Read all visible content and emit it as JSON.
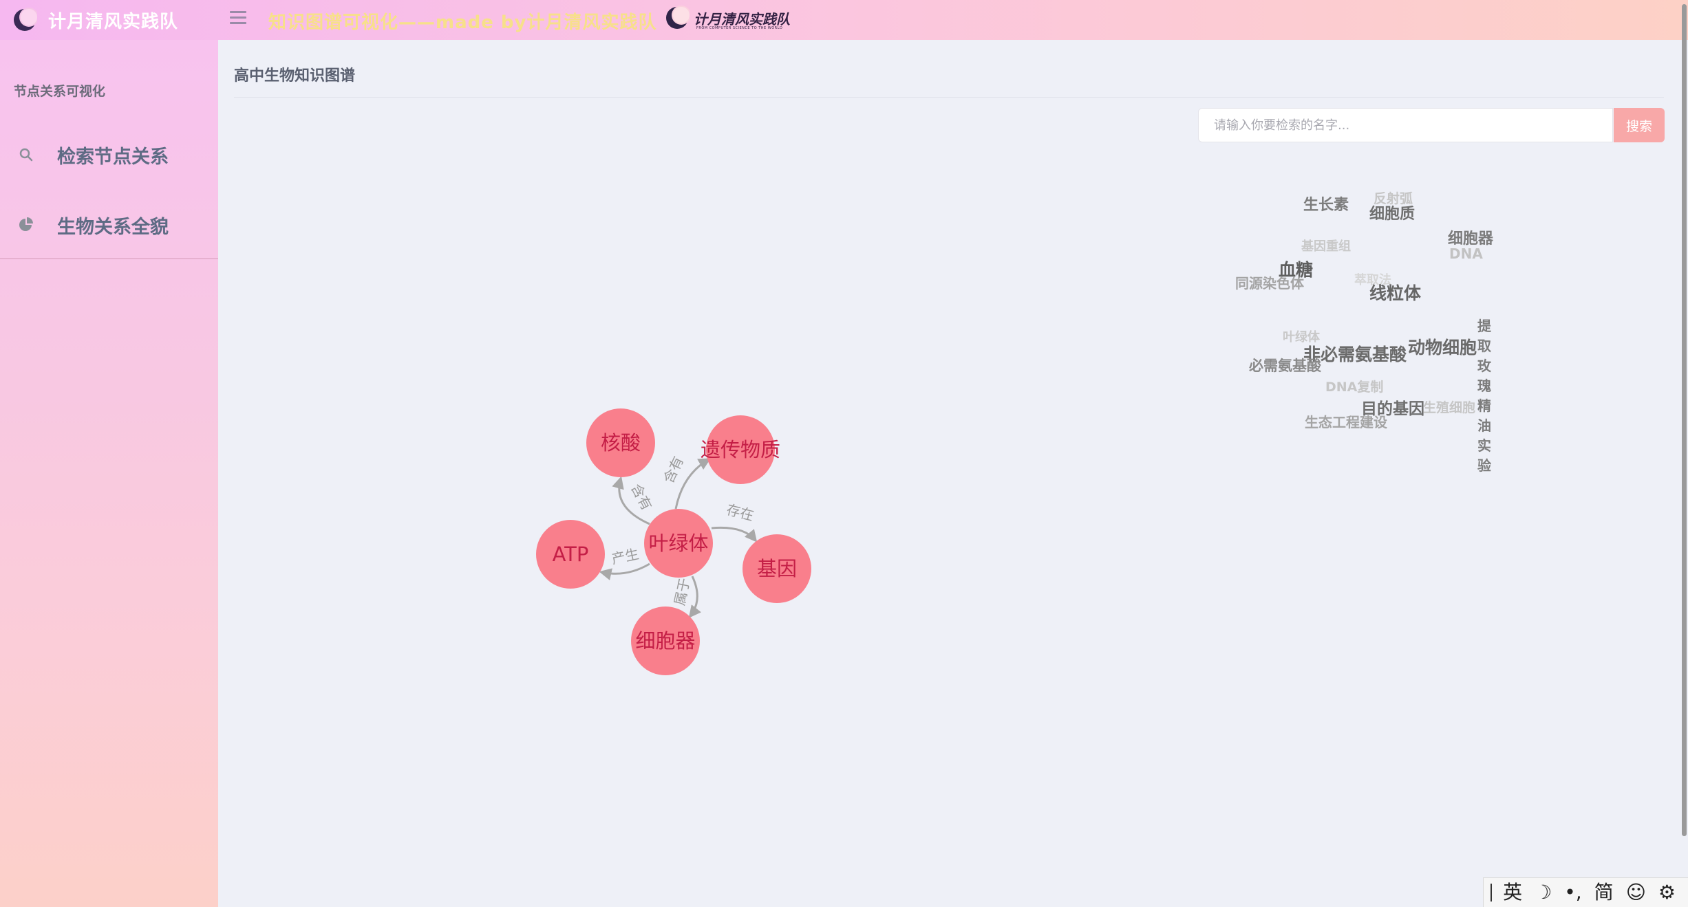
{
  "header": {
    "brand": "计月清风实践队",
    "title": "知识图谱可视化——made by计月清风实践队",
    "logo_text": "计月清风实践队",
    "logo_subtext": "FROM COMPUTER SCIENCE TO THE WORLD"
  },
  "sidebar": {
    "section_title": "节点关系可视化",
    "items": [
      {
        "label": "检索节点关系",
        "icon": "search-icon"
      },
      {
        "label": "生物关系全貌",
        "icon": "pie-chart-icon"
      }
    ]
  },
  "main": {
    "title": "高中生物知识图谱",
    "search": {
      "placeholder": "请输入你要检索的名字...",
      "value": "",
      "button_label": "搜索"
    }
  },
  "graph": {
    "center": "叶绿体",
    "nodes": [
      "叶绿体",
      "核酸",
      "遗传物质",
      "基因",
      "细胞器",
      "ATP"
    ],
    "edges": [
      {
        "from": "叶绿体",
        "to": "核酸",
        "label": "含有"
      },
      {
        "from": "叶绿体",
        "to": "遗传物质",
        "label": "含有"
      },
      {
        "from": "叶绿体",
        "to": "基因",
        "label": "存在"
      },
      {
        "from": "叶绿体",
        "to": "细胞器",
        "label": "属于"
      },
      {
        "from": "叶绿体",
        "to": "ATP",
        "label": "产生"
      }
    ],
    "node_color": "#f97f8c",
    "node_text_color": "#c41e46",
    "edge_color": "#a8a8a8",
    "edge_label_color": "#9a9a9a"
  },
  "word_cloud": {
    "words": [
      {
        "text": "生长素",
        "color": "#7c7c7c"
      },
      {
        "text": "反射弧",
        "color": "#c6c6c6"
      },
      {
        "text": "细胞质",
        "color": "#6f6f6f"
      },
      {
        "text": "细胞器",
        "color": "#7c7c7c"
      },
      {
        "text": "基因重组",
        "color": "#c9c9c9"
      },
      {
        "text": "DNA",
        "color": "#c2c2c2"
      },
      {
        "text": "血糖",
        "color": "#5e5e5e"
      },
      {
        "text": "同源染色体",
        "color": "#a4a4a4"
      },
      {
        "text": "萃取法",
        "color": "#d6d6d6"
      },
      {
        "text": "线粒体",
        "color": "#666666"
      },
      {
        "text": "叶绿体",
        "color": "#c9c9c9"
      },
      {
        "text": "非必需氨基酸",
        "color": "#6a6a6a"
      },
      {
        "text": "动物细胞",
        "color": "#6a6a6a"
      },
      {
        "text": "必需氨基酸",
        "color": "#8a8a8a"
      },
      {
        "text": "DNA复制",
        "color": "#c6c6c6"
      },
      {
        "text": "目的基因",
        "color": "#6e6e6e"
      },
      {
        "text": "生殖细胞",
        "color": "#c6c6c6"
      },
      {
        "text": "生态工程建设",
        "color": "#a4a4a4"
      }
    ],
    "vertical_word": [
      "提",
      "取",
      "玫",
      "瑰",
      "精",
      "油",
      "实",
      "验"
    ]
  },
  "ime": {
    "items": [
      "英",
      "☽",
      "•,",
      "简",
      "☺",
      "⚙"
    ]
  },
  "colors": {
    "accent": "#f8a8a8",
    "sidebar_gradient_top": "#f8c3ef",
    "sidebar_gradient_bottom": "#fcd0c9"
  }
}
